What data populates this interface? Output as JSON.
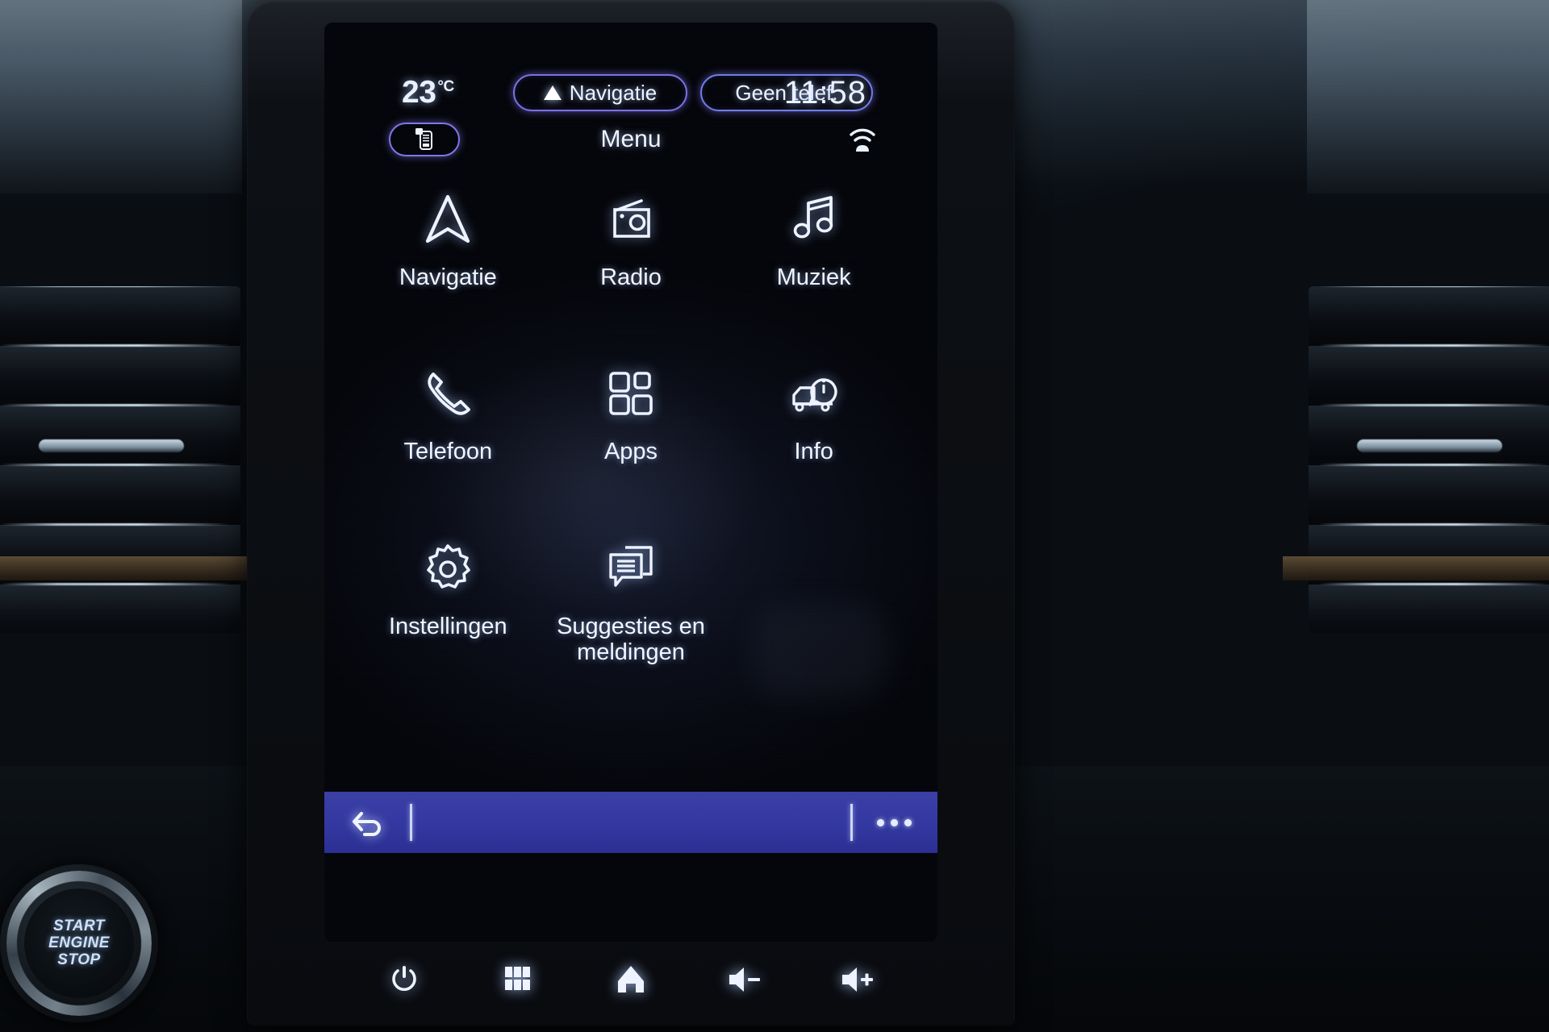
{
  "status_bar": {
    "temperature": "23",
    "temperature_unit": "°C",
    "nav_pill_label": "Navigatie",
    "nav_pill_icon": "navigation-arrow-icon",
    "phone_pill_label": "Geen telef.",
    "clock": "11:58"
  },
  "title_bar": {
    "replication_icon": "smartphone-replication-icon",
    "title": "Menu",
    "connectivity_icon": "wifi-car-icon"
  },
  "menu": {
    "tiles": [
      {
        "label": "Navigatie",
        "icon": "navigation-arrow-icon"
      },
      {
        "label": "Radio",
        "icon": "radio-icon"
      },
      {
        "label": "Muziek",
        "icon": "music-note-icon"
      },
      {
        "label": "Telefoon",
        "icon": "phone-handset-icon"
      },
      {
        "label": "Apps",
        "icon": "apps-grid-icon"
      },
      {
        "label": "Info",
        "icon": "car-info-icon"
      },
      {
        "label": "Instellingen",
        "icon": "gear-icon"
      },
      {
        "label": "Suggesties en meldingen",
        "icon": "messages-icon"
      }
    ]
  },
  "context_bar": {
    "back_icon": "back-arrow-icon",
    "more_icon": "more-dots-icon"
  },
  "hardware_keys": [
    {
      "icon": "power-icon"
    },
    {
      "icon": "apps-grid-icon"
    },
    {
      "icon": "home-icon"
    },
    {
      "icon": "volume-down-icon"
    },
    {
      "icon": "volume-up-icon"
    }
  ],
  "dashboard": {
    "start_button": {
      "line1": "START",
      "line2": "ENGINE",
      "line3": "STOP"
    }
  },
  "colors": {
    "accent_purple": "#7b70e8",
    "context_bar_blue": "#3338a0",
    "text_white": "#f0f4ff",
    "screen_black": "#04050a"
  }
}
